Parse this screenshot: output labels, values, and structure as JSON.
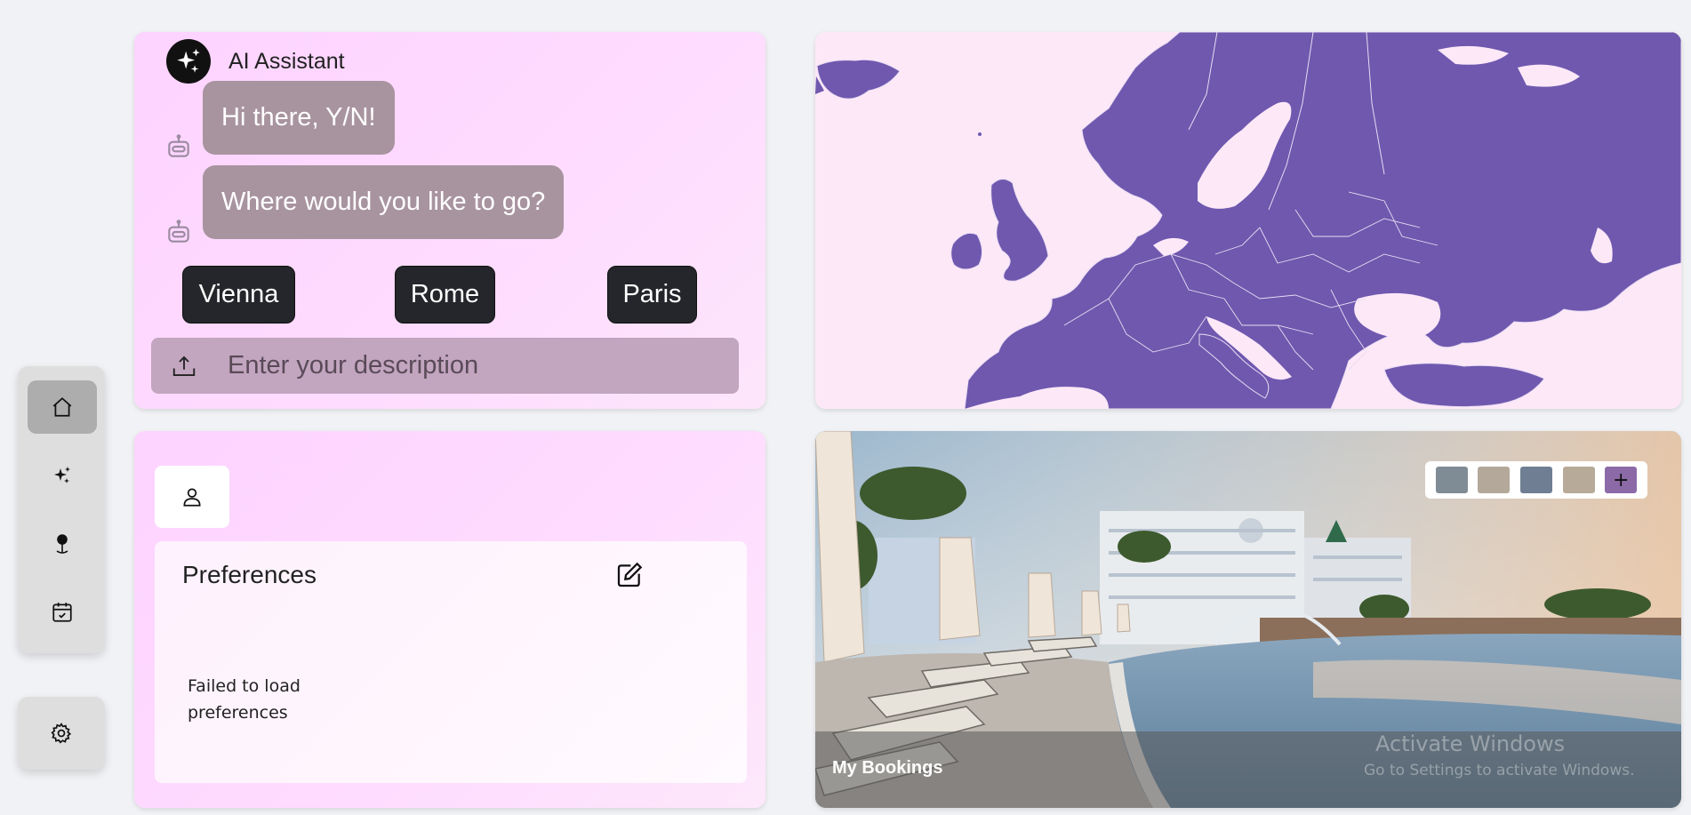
{
  "ai": {
    "title": "AI Assistant",
    "messages": [
      "Hi there, Y/N!",
      "Where would you like to go?"
    ],
    "destinations": [
      "Vienna",
      "Rome",
      "Paris"
    ],
    "input_placeholder": "Enter your description"
  },
  "preferences": {
    "title": "Preferences",
    "error": "Failed to load preferences"
  },
  "bookings": {
    "label": "My Bookings",
    "add_symbol": "+"
  },
  "watermark": {
    "line1": "Activate Windows",
    "line2": "Go to Settings to activate Windows."
  },
  "sidebar": {
    "items": [
      {
        "icon": "home-icon",
        "active": true
      },
      {
        "icon": "sparkles-icon",
        "active": false
      },
      {
        "icon": "location-pin-icon",
        "active": false
      },
      {
        "icon": "calendar-check-icon",
        "active": false
      }
    ],
    "settings_icon": "gear-icon"
  },
  "colors": {
    "map_land": "#6f58ae",
    "map_sea": "#fde8f8",
    "bubble": "#a8949f",
    "button": "#24262b"
  }
}
